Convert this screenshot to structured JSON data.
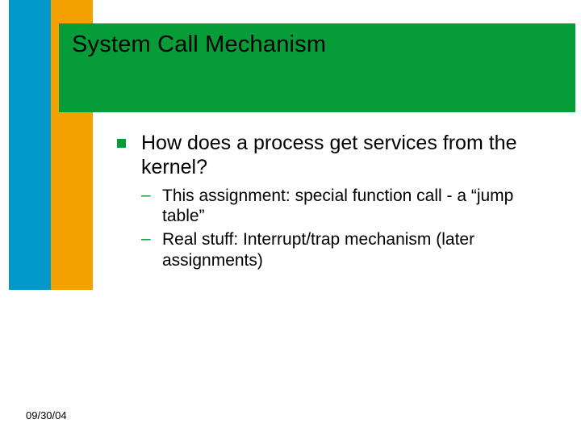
{
  "title": "System Call Mechanism",
  "bullets": {
    "main": "How does a process get services from the kernel?",
    "sub1": "This assignment: special function call - a “jump table”",
    "sub2": "Real stuff: Interrupt/trap mechanism (later assignments)"
  },
  "footer": {
    "date": "09/30/04"
  },
  "colors": {
    "green": "#069c37",
    "orange": "#f4a100",
    "cyan": "#0099cc"
  }
}
